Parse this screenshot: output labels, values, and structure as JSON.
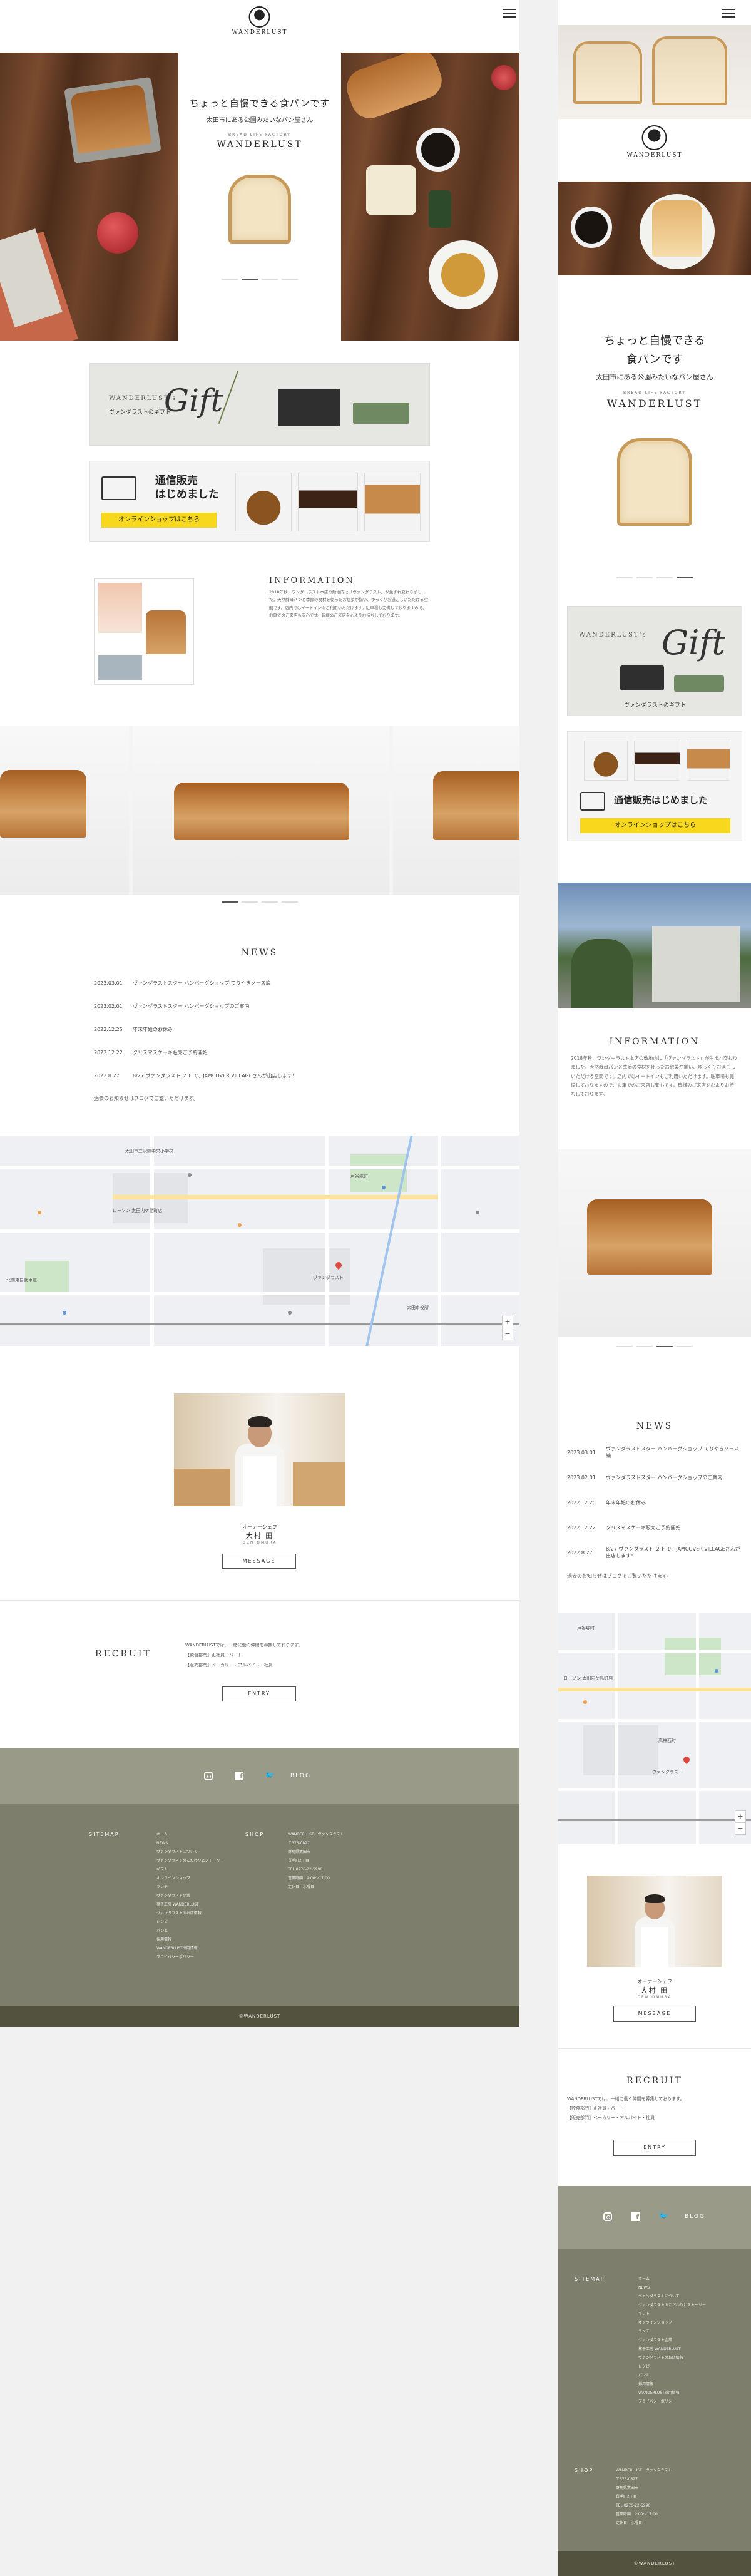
{
  "brand": {
    "name": "WANDERLUST",
    "sub": "BREAD LIFE FACTORY"
  },
  "hero": {
    "catch": "ちょっと自慢できる食パンです",
    "catch_m1": "ちょっと自慢できる",
    "catch_m2": "食パンです",
    "sub": "太田市にある公園みたいなパン屋さん"
  },
  "banners": {
    "gift_brand": "WANDERLUST's",
    "gift_word": "Gift",
    "gift_jp": "ヴァンダラストのギフト",
    "mail_title_1": "通信販売",
    "mail_title_2": "はじめました",
    "mail_title_m": "通信販売はじめました",
    "shop_button": "オンラインショップはこちら"
  },
  "information": {
    "title": "INFORMATION",
    "text": "2018年秋、ワンダーラスト本店の敷地内に「ヴァンダラスト」が生まれ変わりました。天然酵母パンと季節の食材を使ったお惣菜が揃い、ゆっくりお過ごしいただける空間です。店内ではイートインもご利用いただけます。駐車場も完備しておりますので、お車でのご来店も安心です。皆様のご来店を心よりお待ちしております。"
  },
  "news": {
    "title": "NEWS",
    "items": [
      {
        "date": "2023.03.01",
        "text": "ヴァンダラストスター ハンバーグショップ てりやきソース編"
      },
      {
        "date": "2023.02.01",
        "text": "ヴァンダラストスター ハンバーグショップのご案内"
      },
      {
        "date": "2022.12.25",
        "text": "年末年始のお休み"
      },
      {
        "date": "2022.12.22",
        "text": "クリスマスケーキ販売ご予約開始"
      },
      {
        "date": "2022.8.27",
        "text": "8/27 ヴァンダラスト ２ F で、JAMCOVER VILLAGEさんが出店します！"
      }
    ],
    "more": "過去のお知らせはブログでご覧いただけます。"
  },
  "chef": {
    "role": "オーナーシェフ",
    "name": "大村 田",
    "roman": "DEN OMURA",
    "button": "MESSAGE"
  },
  "recruit": {
    "title": "RECRUIT",
    "text": "WANDERLUSTでは、一緒に働く仲間を募集しております。",
    "line1": "【飲食部門】正社員・パート",
    "line2": "【販売部門】ベーカリー・アルバイト・社員",
    "button": "ENTRY"
  },
  "footer": {
    "blog": "BLOG",
    "sitemap_title": "SITEMAP",
    "sitemap": [
      "ホーム",
      "NEWS",
      "ヴァンダラストについて",
      "ヴァンダラストのこだわりとストーリー",
      "ギフト",
      "オンラインショップ",
      "ランチ",
      "ヴァンダラスト企業",
      "菓子工房 WANDERLUST",
      "ヴァンダラストのお店情報",
      "レシピ",
      "パンと",
      "採用情報",
      "WANDERLUST採用情報",
      "プライバシーポリシー"
    ],
    "shop_title": "SHOP",
    "shop": [
      "WANDERLUST　ヴァンダラスト",
      "〒373-0827",
      "群馬県太田市",
      "長手町2丁目",
      "TEL 0276-22-5996",
      "営業時間　9:00〜17:00",
      "定休日　水曜日"
    ],
    "copyright": "©WANDERLUST"
  },
  "map": {
    "labels": [
      "太田市立沢野中央小学校",
      "ローソン 太田内ケ島町店",
      "ヴァンダラスト",
      "戸谷塚町",
      "北関東自動車道",
      "太田市役所",
      "高林西町",
      "新井町"
    ]
  },
  "colors": {
    "footer_olive": "#999a88",
    "footer_dark": "#7e7e6d",
    "copyright_bg": "#52523f",
    "shop_yellow": "#f7d81c"
  }
}
